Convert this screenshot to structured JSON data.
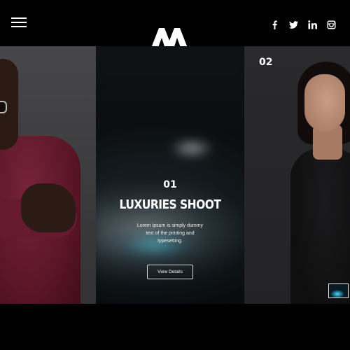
{
  "header": {
    "menu_icon": "hamburger-menu-icon",
    "logo_icon": "brand-logo-m-icon",
    "social": [
      {
        "name": "facebook-icon"
      },
      {
        "name": "twitter-icon"
      },
      {
        "name": "linkedin-icon"
      },
      {
        "name": "instagram-icon"
      }
    ]
  },
  "slides": {
    "right_number": "02",
    "center": {
      "number": "01",
      "title": "LUXURIES SHOOT",
      "description": "Lorem ipsum is simply dummy text of the printing and typesetting.",
      "button_label": "View Details"
    }
  },
  "colors": {
    "background": "#000000",
    "accent_text": "#ffffff"
  }
}
